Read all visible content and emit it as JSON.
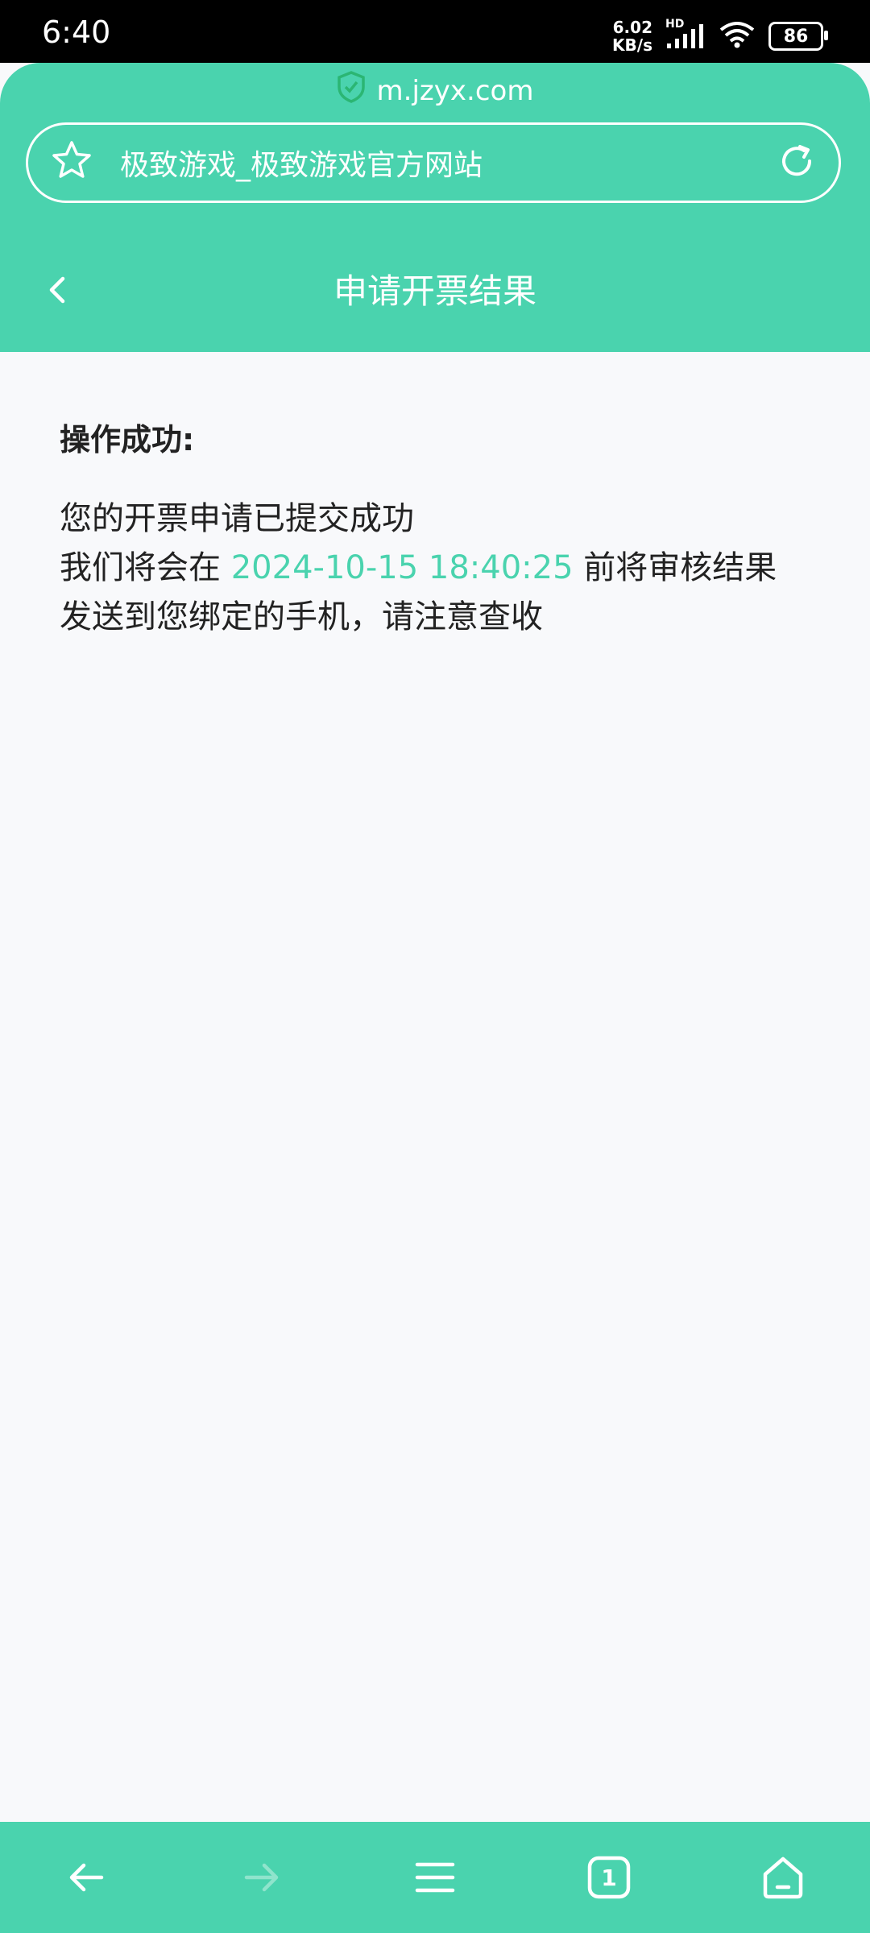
{
  "status_bar": {
    "time": "6:40",
    "net_speed_value": "6.02",
    "net_speed_unit": "KB/s",
    "hd_label": "HD",
    "battery": "86"
  },
  "browser": {
    "domain": "m.jzyx.com",
    "page_title": "极致游戏_极致游戏官方网站"
  },
  "header": {
    "title": "申请开票结果"
  },
  "content": {
    "heading": "操作成功:",
    "line1": "您的开票申请已提交成功",
    "line2_prefix": "我们将会在 ",
    "deadline": "2024-10-15 18:40:25",
    "line2_suffix": " 前将审核结果",
    "line3": "发送到您绑定的手机，请注意查收"
  },
  "bottom_nav": {
    "tab_count": "1"
  },
  "colors": {
    "accent": "#4ad3ae",
    "background": "#f8f9fb"
  }
}
